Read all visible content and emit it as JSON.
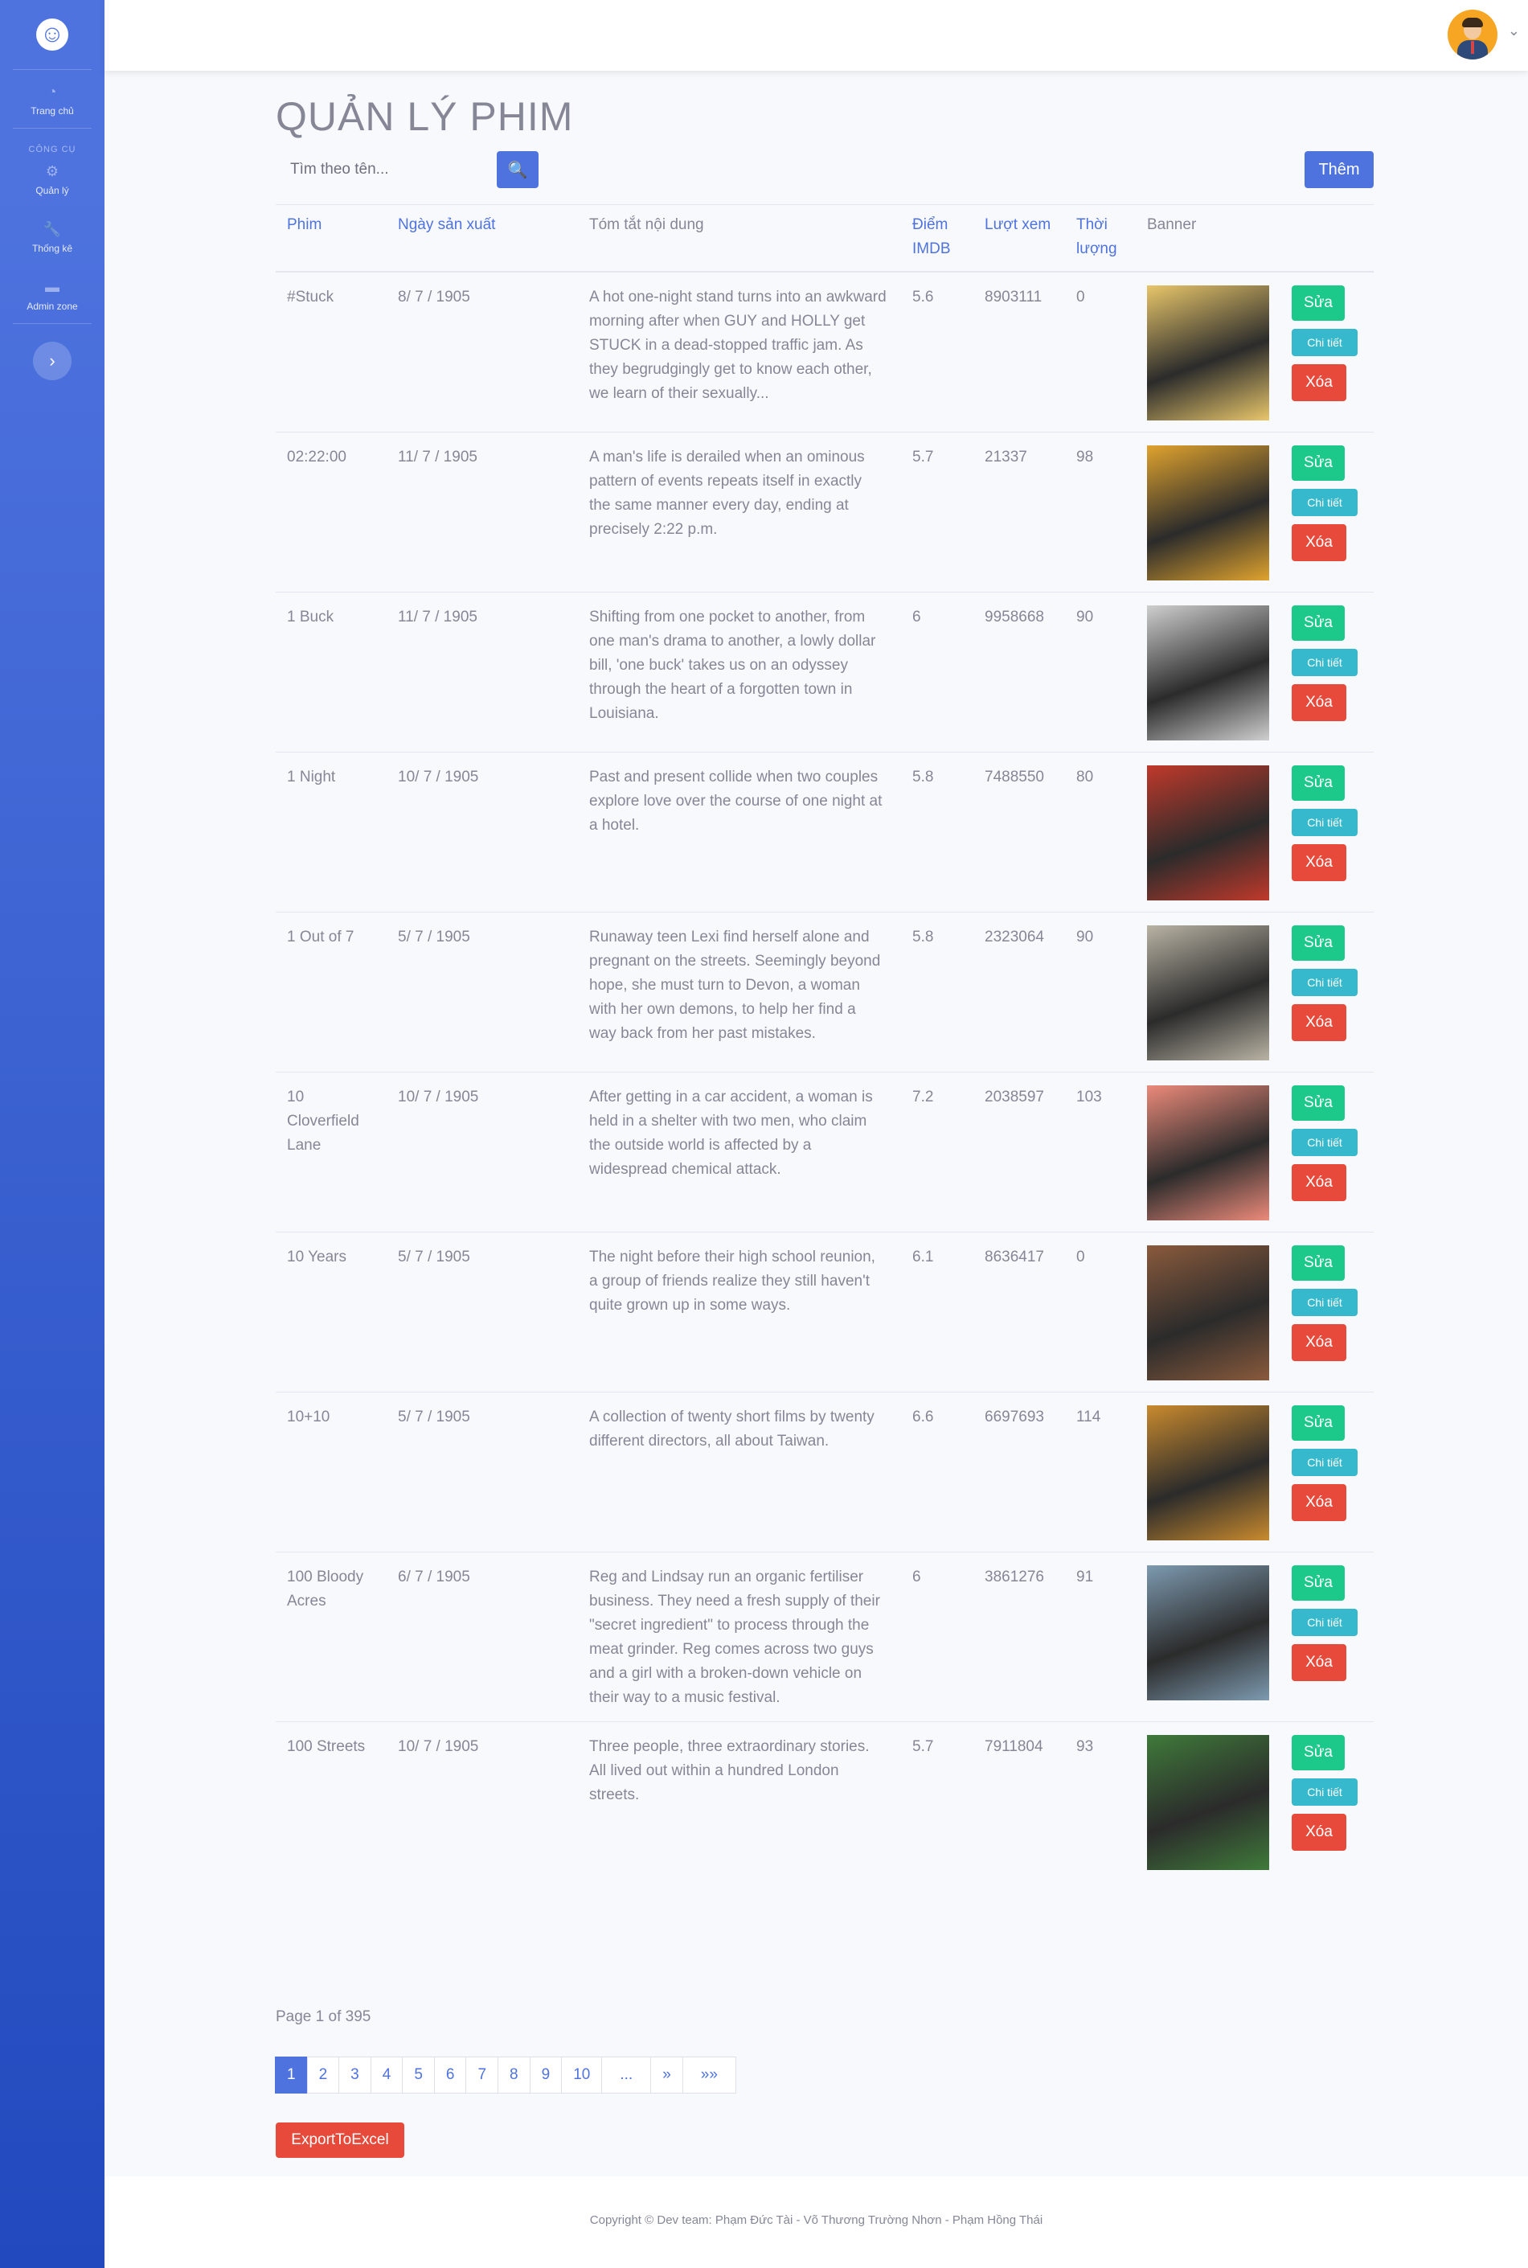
{
  "sidebar": {
    "logo_glyph": "☺",
    "items": [
      {
        "label": "Trang chủ",
        "icon": "dashboard-icon",
        "glyph": "◔"
      },
      {
        "label": "Quản lý",
        "icon": "gear-icon",
        "glyph": "⚙"
      },
      {
        "label": "Thống kê",
        "icon": "wrench-icon",
        "glyph": "🔧"
      },
      {
        "label": "Admin zone",
        "icon": "folder-icon",
        "glyph": "▬"
      }
    ],
    "heading": "CÔNG CỤ",
    "toggle_glyph": "›"
  },
  "topbar": {
    "caret": "⌄"
  },
  "page": {
    "title": "QUẢN LÝ PHIM",
    "search_placeholder": "Tìm theo tên...",
    "search_glyph": "🔍",
    "add_label": "Thêm"
  },
  "table": {
    "headers": {
      "film": "Phim",
      "date": "Ngày sản xuất",
      "summary": "Tóm tắt nội dung",
      "imdb": "Điểm IMDB",
      "views": "Lượt xem",
      "duration": "Thời lượng",
      "banner": "Banner"
    },
    "actions": {
      "edit": "Sửa",
      "detail": "Chi tiết",
      "delete": "Xóa"
    },
    "rows": [
      {
        "name": "#Stuck",
        "date": "8/ 7 / 1905",
        "summary": "A hot one-night stand turns into an awkward morning after when GUY and HOLLY get STUCK in a dead-stopped traffic jam. As they begrudgingly get to know each other, we learn of their sexually...",
        "imdb": "5.6",
        "views": "8903111",
        "duration": "0",
        "poster_color": "#e8c66a"
      },
      {
        "name": "02:22:00",
        "date": "11/ 7 / 1905",
        "summary": "A man's life is derailed when an ominous pattern of events repeats itself in exactly the same manner every day, ending at precisely 2:22 p.m.",
        "imdb": "5.7",
        "views": "21337",
        "duration": "98",
        "poster_color": "#e0a32e"
      },
      {
        "name": "1 Buck",
        "date": "11/ 7 / 1905",
        "summary": "Shifting from one pocket to another, from one man's drama to another, a lowly dollar bill, 'one buck' takes us on an odyssey through the heart of a forgotten town in Louisiana.",
        "imdb": "6",
        "views": "9958668",
        "duration": "90",
        "poster_color": "#cfcfcf"
      },
      {
        "name": "1 Night",
        "date": "10/ 7 / 1905",
        "summary": "Past and present collide when two couples explore love over the course of one night at a hotel.",
        "imdb": "5.8",
        "views": "7488550",
        "duration": "80",
        "poster_color": "#c0392b"
      },
      {
        "name": "1 Out of 7",
        "date": "5/ 7 / 1905",
        "summary": "Runaway teen Lexi find herself alone and pregnant on the streets. Seemingly beyond hope, she must turn to Devon, a woman with her own demons, to help her find a way back from her past mistakes.",
        "imdb": "5.8",
        "views": "2323064",
        "duration": "90",
        "poster_color": "#b9b3a4"
      },
      {
        "name": "10 Cloverfield Lane",
        "date": "10/ 7 / 1905",
        "summary": "After getting in a car accident, a woman is held in a shelter with two men, who claim the outside world is affected by a widespread chemical attack.",
        "imdb": "7.2",
        "views": "2038597",
        "duration": "103",
        "poster_color": "#ec8a7a"
      },
      {
        "name": "10 Years",
        "date": "5/ 7 / 1905",
        "summary": "The night before their high school reunion, a group of friends realize they still haven't quite grown up in some ways.",
        "imdb": "6.1",
        "views": "8636417",
        "duration": "0",
        "poster_color": "#8a5a3c"
      },
      {
        "name": "10+10",
        "date": "5/ 7 / 1905",
        "summary": "A collection of twenty short films by twenty different directors, all about Taiwan.",
        "imdb": "6.6",
        "views": "6697693",
        "duration": "114",
        "poster_color": "#c98a2e"
      },
      {
        "name": "100 Bloody Acres",
        "date": "6/ 7 / 1905",
        "summary": "Reg and Lindsay run an organic fertiliser business. They need a fresh supply of their \"secret ingredient\" to process through the meat grinder. Reg comes across two guys and a girl with a broken-down vehicle on their way to a music festival.",
        "imdb": "6",
        "views": "3861276",
        "duration": "91",
        "poster_color": "#7d9ab0"
      },
      {
        "name": "100 Streets",
        "date": "10/ 7 / 1905",
        "summary": "Three people, three extraordinary stories. All lived out within a hundred London streets.",
        "imdb": "5.7",
        "views": "7911804",
        "duration": "93",
        "poster_color": "#3f7a3a"
      }
    ]
  },
  "pagination": {
    "info": "Page 1 of 395",
    "pages": [
      "1",
      "2",
      "3",
      "4",
      "5",
      "6",
      "7",
      "8",
      "9",
      "10",
      "...",
      "»",
      "»»"
    ]
  },
  "export_label": "ExportToExcel",
  "footer": "Copyright © Dev team: Phạm Đức Tài - Võ Thương Trường Nhơn - Phạm Hồng Thái"
}
